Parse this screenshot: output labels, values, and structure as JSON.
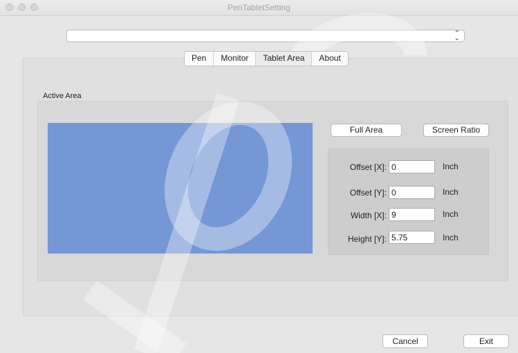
{
  "window": {
    "title": "PenTabletSetting"
  },
  "device_combo": {
    "value": "",
    "arrow_glyph": "⌃⌄"
  },
  "tabs": [
    {
      "label": "Pen",
      "active": false
    },
    {
      "label": "Monitor",
      "active": false
    },
    {
      "label": "Tablet Area",
      "active": true
    },
    {
      "label": "About",
      "active": false
    }
  ],
  "active_area": {
    "section_label": "Active Area",
    "preview_color": "#7597d6",
    "full_area_label": "Full Area",
    "screen_ratio_label": "Screen Ratio",
    "fields": [
      {
        "label": "Offset [X]:",
        "value": "0",
        "unit": "Inch"
      },
      {
        "label": "Offset [Y]:",
        "value": "0",
        "unit": "Inch"
      },
      {
        "label": "Width [X]:",
        "value": "9",
        "unit": "Inch"
      },
      {
        "label": "Height [Y]:",
        "value": "5.75",
        "unit": "Inch"
      }
    ]
  },
  "footer": {
    "cancel_label": "Cancel",
    "exit_label": "Exit"
  },
  "colors": {
    "window_bg": "#e6e6e6",
    "panel_bg": "#e0e0e0",
    "group_bg": "#d8d8d8",
    "fields_bg": "#cdcdcd"
  }
}
